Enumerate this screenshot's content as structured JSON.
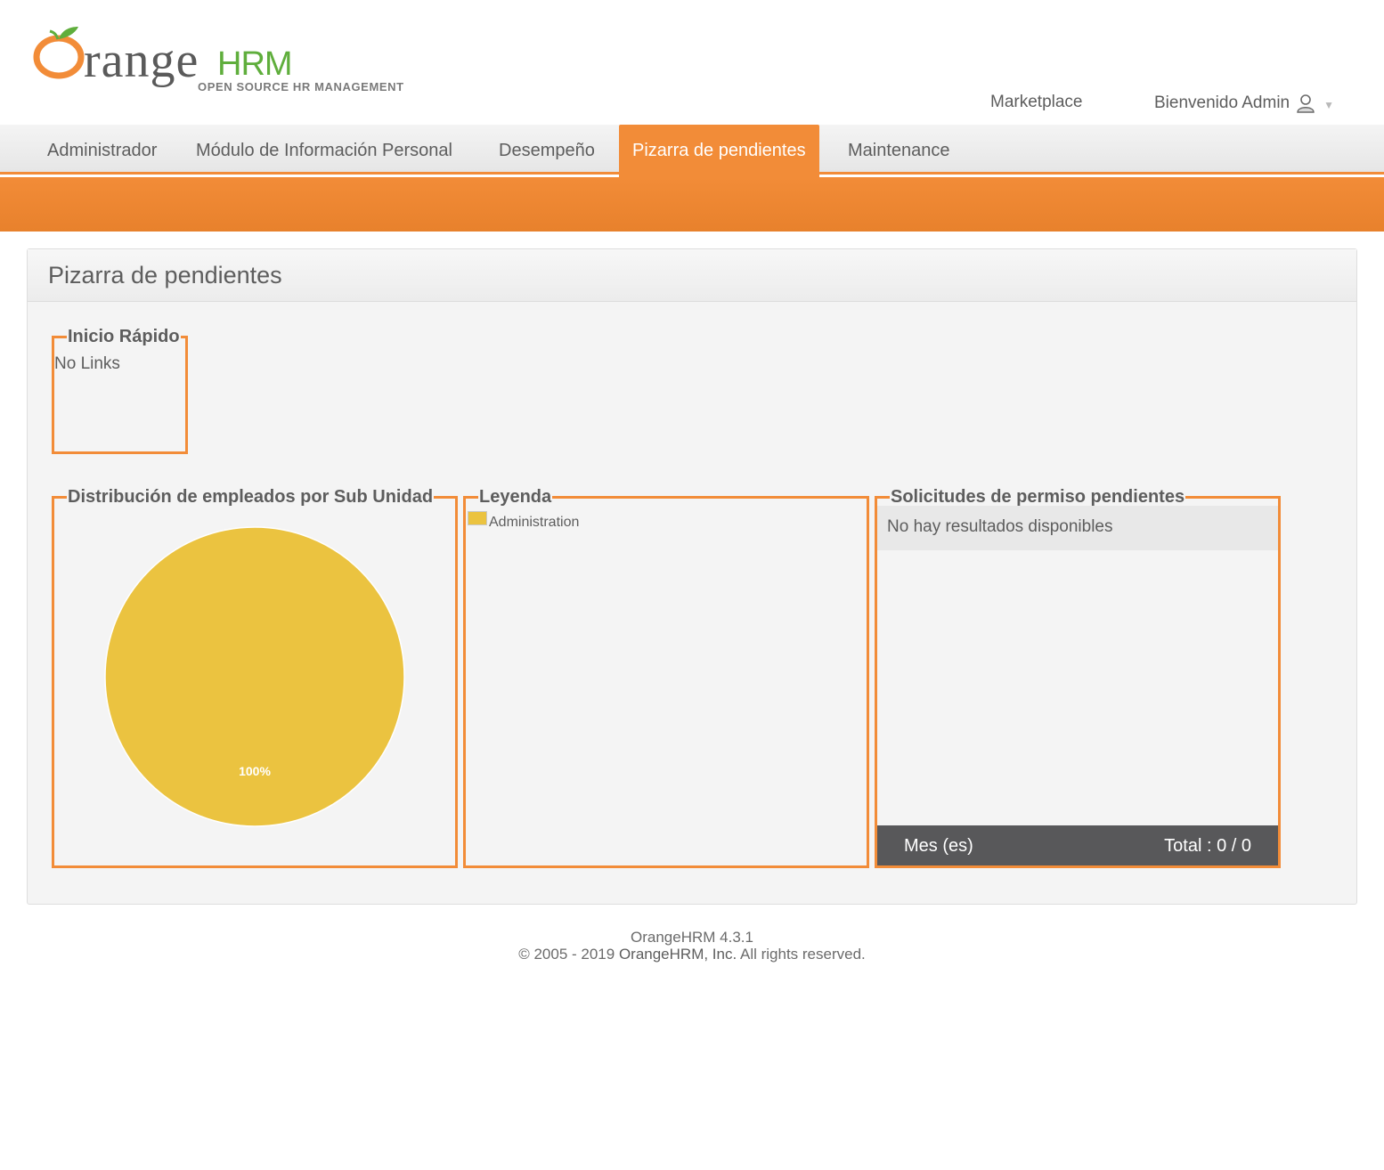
{
  "header": {
    "logo_word": "range",
    "logo_hrm": "HRM",
    "logo_tagline": "OPEN SOURCE HR MANAGEMENT",
    "marketplace_label": "Marketplace",
    "welcome_label": "Bienvenido Admin"
  },
  "menu": {
    "items": [
      {
        "label": "Administrador",
        "active": false
      },
      {
        "label": "Módulo de Información Personal",
        "active": false
      },
      {
        "label": "Desempeño",
        "active": false
      },
      {
        "label": "Pizarra de pendientes",
        "active": true
      },
      {
        "label": "Maintenance",
        "active": false
      }
    ]
  },
  "page": {
    "title": "Pizarra de pendientes"
  },
  "quick_launch": {
    "title": "Inicio Rápido",
    "empty_text": "No Links"
  },
  "distribution": {
    "title": "Distribución de empleados por Sub Unidad"
  },
  "legend_panel": {
    "title": "Leyenda",
    "items": [
      {
        "label": "Administration",
        "color": "#ebc340"
      }
    ]
  },
  "leave_requests": {
    "title": "Solicitudes de permiso pendientes",
    "empty_text": "No hay resultados disponibles",
    "footer_month": "Mes (es)",
    "footer_total": "Total : 0 / 0"
  },
  "chart_data": {
    "type": "pie",
    "categories": [
      "Administration"
    ],
    "values": [
      100
    ],
    "labels": [
      "100%"
    ],
    "colors": [
      "#ebc340"
    ]
  },
  "footer": {
    "version": "OrangeHRM 4.3.1",
    "copyright_prefix": "© 2005 - 2019 ",
    "company": "OrangeHRM, Inc.",
    "copyright_suffix": " All rights reserved."
  },
  "colors": {
    "accent": "#f28c38",
    "logo_green": "#5fae3c",
    "pie": "#ebc340"
  }
}
